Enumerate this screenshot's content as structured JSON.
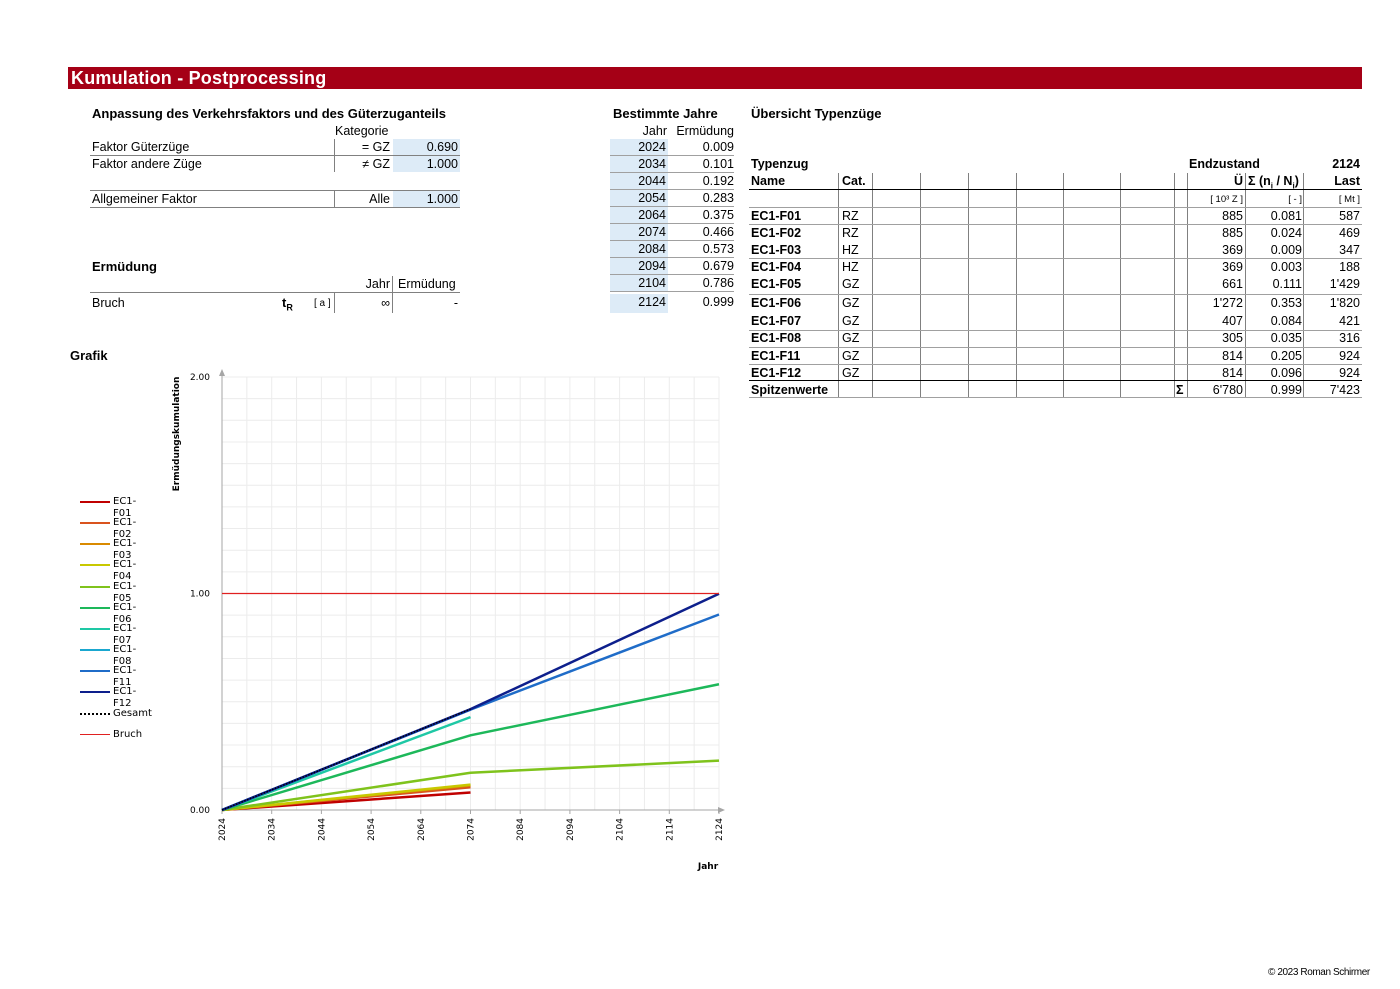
{
  "header": {
    "title": "Kumulation  - Postprocessing"
  },
  "anpassung": {
    "title": "Anpassung des Verkehrsfaktors und des Güterzuganteils",
    "kategorie_header": "Kategorie",
    "rows": [
      {
        "label": "Faktor Güterzüge",
        "kategorie": "= GZ",
        "value": "0.690"
      },
      {
        "label": "Faktor andere Züge",
        "kategorie": "≠ GZ",
        "value": "1.000"
      }
    ],
    "allg": {
      "label": "Allgemeiner Faktor",
      "kategorie": "Alle",
      "value": "1.000"
    }
  },
  "ermuedung": {
    "title": "Ermüdung",
    "col_jahr": "Jahr",
    "col_ermuedung": "Ermüdung",
    "bruch_label": "Bruch",
    "symbol": "t",
    "symbol_sub": "R",
    "unit": "[ a ]",
    "jahr_value": "∞",
    "ermuedung_value": "-"
  },
  "bestimmte_jahre": {
    "title": "Bestimmte Jahre",
    "col_jahr": "Jahr",
    "col_ermuedung": "Ermüdung",
    "rows": [
      {
        "jahr": "2024",
        "wert": "0.009"
      },
      {
        "jahr": "2034",
        "wert": "0.101"
      },
      {
        "jahr": "2044",
        "wert": "0.192"
      },
      {
        "jahr": "2054",
        "wert": "0.283"
      },
      {
        "jahr": "2064",
        "wert": "0.375"
      },
      {
        "jahr": "2074",
        "wert": "0.466"
      },
      {
        "jahr": "2084",
        "wert": "0.573"
      },
      {
        "jahr": "2094",
        "wert": "0.679"
      },
      {
        "jahr": "2104",
        "wert": "0.786"
      },
      {
        "jahr": "2124",
        "wert": "0.999"
      }
    ]
  },
  "uebersicht": {
    "title": "Übersicht Typenzüge",
    "typenzug": "Typenzug",
    "name": "Name",
    "cat": "Cat.",
    "endzustand": "Endzustand",
    "endjahr": "2124",
    "col_u": "Ü",
    "col_sum": "Σ (n",
    "col_sum_sub1": "i",
    "col_sum_mid": " / N",
    "col_sum_sub2": "i",
    "col_sum_end": ")",
    "col_last": "Last",
    "unit_u": "[ 10³ Z ]",
    "unit_sum": "[ - ]",
    "unit_last": "[ Mt ]",
    "rows": [
      {
        "name": "EC1-F01",
        "cat": "RZ",
        "u": "885",
        "sum": "0.081",
        "last": "587"
      },
      {
        "name": "EC1-F02",
        "cat": "RZ",
        "u": "885",
        "sum": "0.024",
        "last": "469"
      },
      {
        "name": "EC1-F03",
        "cat": "HZ",
        "u": "369",
        "sum": "0.009",
        "last": "347"
      },
      {
        "name": "EC1-F04",
        "cat": "HZ",
        "u": "369",
        "sum": "0.003",
        "last": "188"
      },
      {
        "name": "EC1-F05",
        "cat": "GZ",
        "u": "661",
        "sum": "0.111",
        "last": "1'429"
      },
      {
        "name": "EC1-F06",
        "cat": "GZ",
        "u": "1'272",
        "sum": "0.353",
        "last": "1'820"
      },
      {
        "name": "EC1-F07",
        "cat": "GZ",
        "u": "407",
        "sum": "0.084",
        "last": "421"
      },
      {
        "name": "EC1-F08",
        "cat": "GZ",
        "u": "305",
        "sum": "0.035",
        "last": "316"
      },
      {
        "name": "EC1-F11",
        "cat": "GZ",
        "u": "814",
        "sum": "0.205",
        "last": "924"
      },
      {
        "name": "EC1-F12",
        "cat": "GZ",
        "u": "814",
        "sum": "0.096",
        "last": "924"
      }
    ],
    "total": {
      "label": "Spitzenwerte",
      "sigma": "Σ",
      "u": "6'780",
      "sum": "0.999",
      "last": "7'423"
    }
  },
  "grafik": {
    "title": "Grafik"
  },
  "chart_data": {
    "type": "line",
    "title": "",
    "ylabel": "Ermüdungskumulation",
    "xlabel": "Jahr",
    "xlim": [
      2024,
      2124
    ],
    "ylim": [
      0,
      2
    ],
    "xticks": [
      "2024",
      "2034",
      "2044",
      "2054",
      "2064",
      "2074",
      "2084",
      "2094",
      "2104",
      "2114",
      "2124"
    ],
    "yticks": [
      "0.00",
      "1.00",
      "2.00"
    ],
    "grid": true,
    "legend_position": "left",
    "series": [
      {
        "name": "EC1-F01",
        "color": "#c00000",
        "points": [
          [
            2024,
            0
          ],
          [
            2074,
            0.081
          ]
        ]
      },
      {
        "name": "EC1-F02",
        "color": "#d9531e",
        "points": [
          [
            2024,
            0
          ],
          [
            2074,
            0.105
          ]
        ]
      },
      {
        "name": "EC1-F03",
        "color": "#d98a00",
        "points": [
          [
            2024,
            0
          ],
          [
            2074,
            0.114
          ]
        ]
      },
      {
        "name": "EC1-F04",
        "color": "#c8c800",
        "points": [
          [
            2024,
            0
          ],
          [
            2074,
            0.117
          ]
        ]
      },
      {
        "name": "EC1-F05",
        "color": "#7fc31c",
        "points": [
          [
            2024,
            0
          ],
          [
            2074,
            0.172
          ],
          [
            2124,
            0.228
          ]
        ]
      },
      {
        "name": "EC1-F06",
        "color": "#1db85a",
        "points": [
          [
            2024,
            0
          ],
          [
            2074,
            0.345
          ],
          [
            2124,
            0.581
          ]
        ]
      },
      {
        "name": "EC1-F07",
        "color": "#1ec8a5",
        "points": [
          [
            2024,
            0
          ],
          [
            2074,
            0.429
          ]
        ]
      },
      {
        "name": "EC1-F08",
        "color": "#1aa7cf",
        "points": [
          [
            2024,
            0
          ],
          [
            2074,
            0.464
          ]
        ]
      },
      {
        "name": "EC1-F11",
        "color": "#1f6cc8",
        "points": [
          [
            2024,
            0
          ],
          [
            2074,
            0.464
          ],
          [
            2124,
            0.903
          ]
        ]
      },
      {
        "name": "EC1-F12",
        "color": "#0d1f8c",
        "points": [
          [
            2024,
            0
          ],
          [
            2074,
            0.466
          ],
          [
            2124,
            0.999
          ]
        ]
      },
      {
        "name": "Gesamt",
        "color": "#000000",
        "dashed": true,
        "points": [
          [
            2024,
            0
          ],
          [
            2074,
            0.466
          ]
        ]
      },
      {
        "name": "Bruch",
        "color": "#e02020",
        "points": [
          [
            2024,
            1
          ],
          [
            2124,
            1
          ]
        ]
      }
    ]
  },
  "footer": {
    "copyright": "© 2023 Roman Schirmer"
  }
}
